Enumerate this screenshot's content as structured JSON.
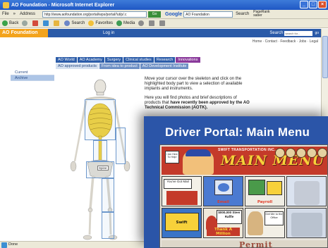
{
  "browser": {
    "title": "AO Foundation - Microsoft Internet Explorer",
    "menu": [
      "File",
      "»",
      "Address"
    ],
    "address": "http://www.aofoundation.org/portal/wps/portal/!ut/p/.c",
    "go_label": "Go",
    "google_label": "Google",
    "google_query": "AO Foundation",
    "search_label": "Search",
    "pagerank_label": "PageRank",
    "pagerank_sub": "saber",
    "toolbar": {
      "back": "Back",
      "search": "Search",
      "favorites": "Favorites",
      "media": "Media"
    },
    "status": "Done",
    "win_buttons": [
      "_",
      "□",
      "×"
    ]
  },
  "page": {
    "logo": "AO Foundation",
    "login": "Log in",
    "search_label": "Search",
    "search_placeholder": "search for...",
    "search_go": "go",
    "top_links": "Home · Contact · Feedback · Jobs · Legal",
    "tabs": [
      "AO World",
      "AO Academy",
      "Surgery",
      "Clinical studies",
      "Research",
      "Innovations"
    ],
    "subtabs": [
      "AO approved products",
      "From idea to product",
      "AO Development Institute"
    ],
    "sidenav": [
      "Current",
      "Archive"
    ],
    "spine_tooltip": "Spine",
    "intro_p1": "Move your cursor over the skeleton and click on the highlighted body part to view a selection of available implants and instruments.",
    "intro_p2_a": "Here you will find photos and brief descriptions of products that",
    "intro_p2_b": "have recently been approved by the AO Technical Commission (AOTK)."
  },
  "driver_portal": {
    "title": "Driver Portal:  Main Menu",
    "banner_sub": "SWIFT TRANSPORTATION INC.",
    "banner_title": "MAIN MENU",
    "sign_text": "I Am Here To Help!",
    "tiles_row1": [
      {
        "label": "",
        "caption": "You've Got Mail"
      },
      {
        "label": "Email"
      },
      {
        "label": "Payroll"
      },
      {
        "label": ""
      }
    ],
    "tiles_row2": [
      {
        "label": "Swift"
      },
      {
        "label": "Thank A Million",
        "caption": "$000,000 Steer Raffle"
      },
      {
        "label": "",
        "caption": "Get Me to the Office"
      },
      {
        "label": ""
      }
    ],
    "bottom_label": "Permit"
  },
  "colors": {
    "ao_blue": "#2a5aa8",
    "ao_orange": "#f3a31c",
    "portal_blue": "#2b55a8",
    "menu_red": "#c43a2a",
    "menu_yellow": "#f7d13a"
  }
}
